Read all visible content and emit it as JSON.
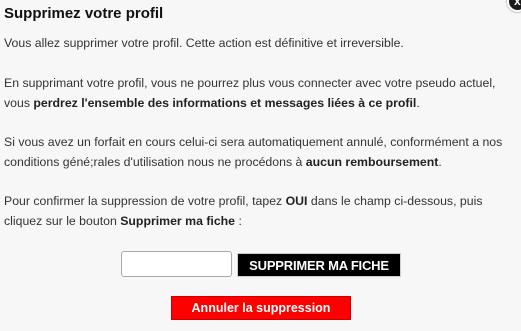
{
  "dialog": {
    "title": "Supprimez votre profil",
    "close_icon": "close-icon",
    "close_glyph": "x"
  },
  "paragraphs": {
    "p1": "Vous allez supprimer votre profil. Cette action est définitive et irreversible.",
    "p2_text": "En supprimant votre profil, vous ne pourrez plus vous connecter avec votre pseudo actuel, vous ",
    "p2_bold": "perdrez l'ensemble des informations et messages liées à ce profil",
    "p2_end": ".",
    "p3_text": "Si vous avez un forfait en cours celui-ci sera automatiquement annulé, conformément a nos conditions géné;rales d'utilisation nous ne procédons à ",
    "p3_bold": "aucun remboursement",
    "p3_end": ".",
    "p4_text1": "Pour confirmer la suppression de votre profil, tapez ",
    "p4_bold1": "OUI",
    "p4_text2": " dans le champ ci-dessous, puis cliquez sur le bouton ",
    "p4_bold2": "Supprimer ma fiche",
    "p4_end": " :"
  },
  "form": {
    "input_value": "",
    "delete_label": "SUPPRIMER MA FICHE",
    "cancel_label": "Annuler la suppression"
  },
  "colors": {
    "delete_bg": "#000000",
    "cancel_bg": "#ff0000",
    "page_bg": "#f7f7f7"
  }
}
